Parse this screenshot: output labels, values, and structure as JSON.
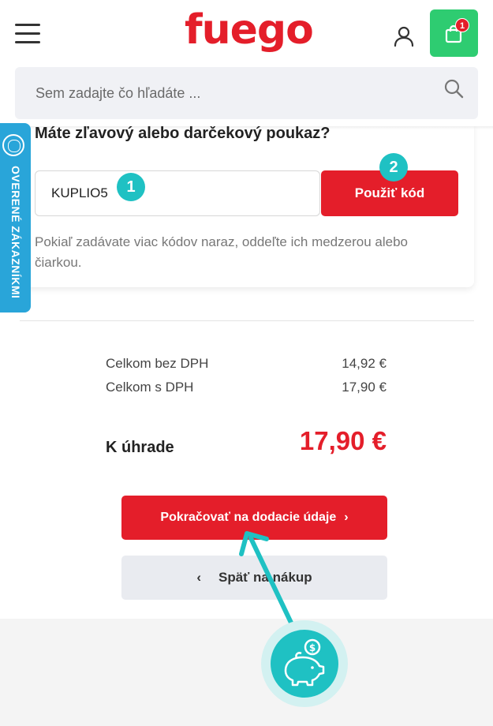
{
  "header": {
    "logo": "fuego",
    "cart_count": "1",
    "search_placeholder": "Sem zadajte čo hľadáte ..."
  },
  "verified_tab": {
    "label": "OVERENÉ ZÁKAZNÍKMI"
  },
  "coupon": {
    "title": "Máte zľavový alebo darčekový poukaz?",
    "code_value": "KUPLIO5",
    "apply_label": "Použiť kód",
    "hint": "Pokiaľ zadávate viac kódov naraz, oddeľte ich medzerou alebo čiarkou."
  },
  "annotations": {
    "step1": "1",
    "step2": "2"
  },
  "summary": {
    "rows": [
      {
        "label": "Celkom bez DPH",
        "value": "14,92 €"
      },
      {
        "label": "Celkom s DPH",
        "value": "17,90 €"
      }
    ],
    "due_label": "K úhrade",
    "due_value": "17,90 €"
  },
  "actions": {
    "continue_label": "Pokračovať na dodacie údaje",
    "back_label": "Späť na nákup"
  },
  "colors": {
    "brand_red": "#e41e2a",
    "cart_green": "#2ecc71",
    "accent_teal": "#1fc1c3",
    "verified_blue": "#29a5d9"
  }
}
